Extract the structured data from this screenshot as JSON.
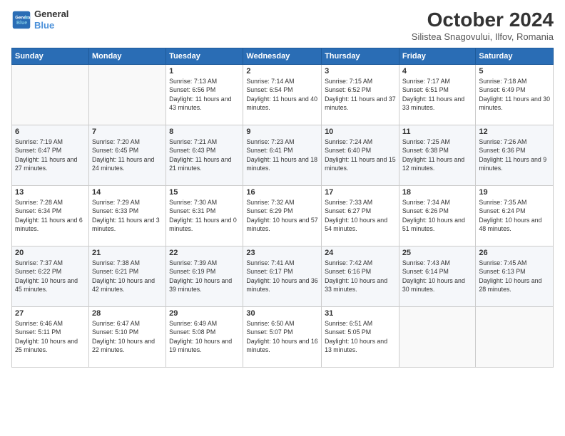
{
  "header": {
    "logo_line1": "General",
    "logo_line2": "Blue",
    "month_title": "October 2024",
    "subtitle": "Silistea Snagovului, Ilfov, Romania"
  },
  "days_of_week": [
    "Sunday",
    "Monday",
    "Tuesday",
    "Wednesday",
    "Thursday",
    "Friday",
    "Saturday"
  ],
  "weeks": [
    [
      {
        "day": "",
        "text": ""
      },
      {
        "day": "",
        "text": ""
      },
      {
        "day": "1",
        "text": "Sunrise: 7:13 AM\nSunset: 6:56 PM\nDaylight: 11 hours and 43 minutes."
      },
      {
        "day": "2",
        "text": "Sunrise: 7:14 AM\nSunset: 6:54 PM\nDaylight: 11 hours and 40 minutes."
      },
      {
        "day": "3",
        "text": "Sunrise: 7:15 AM\nSunset: 6:52 PM\nDaylight: 11 hours and 37 minutes."
      },
      {
        "day": "4",
        "text": "Sunrise: 7:17 AM\nSunset: 6:51 PM\nDaylight: 11 hours and 33 minutes."
      },
      {
        "day": "5",
        "text": "Sunrise: 7:18 AM\nSunset: 6:49 PM\nDaylight: 11 hours and 30 minutes."
      }
    ],
    [
      {
        "day": "6",
        "text": "Sunrise: 7:19 AM\nSunset: 6:47 PM\nDaylight: 11 hours and 27 minutes."
      },
      {
        "day": "7",
        "text": "Sunrise: 7:20 AM\nSunset: 6:45 PM\nDaylight: 11 hours and 24 minutes."
      },
      {
        "day": "8",
        "text": "Sunrise: 7:21 AM\nSunset: 6:43 PM\nDaylight: 11 hours and 21 minutes."
      },
      {
        "day": "9",
        "text": "Sunrise: 7:23 AM\nSunset: 6:41 PM\nDaylight: 11 hours and 18 minutes."
      },
      {
        "day": "10",
        "text": "Sunrise: 7:24 AM\nSunset: 6:40 PM\nDaylight: 11 hours and 15 minutes."
      },
      {
        "day": "11",
        "text": "Sunrise: 7:25 AM\nSunset: 6:38 PM\nDaylight: 11 hours and 12 minutes."
      },
      {
        "day": "12",
        "text": "Sunrise: 7:26 AM\nSunset: 6:36 PM\nDaylight: 11 hours and 9 minutes."
      }
    ],
    [
      {
        "day": "13",
        "text": "Sunrise: 7:28 AM\nSunset: 6:34 PM\nDaylight: 11 hours and 6 minutes."
      },
      {
        "day": "14",
        "text": "Sunrise: 7:29 AM\nSunset: 6:33 PM\nDaylight: 11 hours and 3 minutes."
      },
      {
        "day": "15",
        "text": "Sunrise: 7:30 AM\nSunset: 6:31 PM\nDaylight: 11 hours and 0 minutes."
      },
      {
        "day": "16",
        "text": "Sunrise: 7:32 AM\nSunset: 6:29 PM\nDaylight: 10 hours and 57 minutes."
      },
      {
        "day": "17",
        "text": "Sunrise: 7:33 AM\nSunset: 6:27 PM\nDaylight: 10 hours and 54 minutes."
      },
      {
        "day": "18",
        "text": "Sunrise: 7:34 AM\nSunset: 6:26 PM\nDaylight: 10 hours and 51 minutes."
      },
      {
        "day": "19",
        "text": "Sunrise: 7:35 AM\nSunset: 6:24 PM\nDaylight: 10 hours and 48 minutes."
      }
    ],
    [
      {
        "day": "20",
        "text": "Sunrise: 7:37 AM\nSunset: 6:22 PM\nDaylight: 10 hours and 45 minutes."
      },
      {
        "day": "21",
        "text": "Sunrise: 7:38 AM\nSunset: 6:21 PM\nDaylight: 10 hours and 42 minutes."
      },
      {
        "day": "22",
        "text": "Sunrise: 7:39 AM\nSunset: 6:19 PM\nDaylight: 10 hours and 39 minutes."
      },
      {
        "day": "23",
        "text": "Sunrise: 7:41 AM\nSunset: 6:17 PM\nDaylight: 10 hours and 36 minutes."
      },
      {
        "day": "24",
        "text": "Sunrise: 7:42 AM\nSunset: 6:16 PM\nDaylight: 10 hours and 33 minutes."
      },
      {
        "day": "25",
        "text": "Sunrise: 7:43 AM\nSunset: 6:14 PM\nDaylight: 10 hours and 30 minutes."
      },
      {
        "day": "26",
        "text": "Sunrise: 7:45 AM\nSunset: 6:13 PM\nDaylight: 10 hours and 28 minutes."
      }
    ],
    [
      {
        "day": "27",
        "text": "Sunrise: 6:46 AM\nSunset: 5:11 PM\nDaylight: 10 hours and 25 minutes."
      },
      {
        "day": "28",
        "text": "Sunrise: 6:47 AM\nSunset: 5:10 PM\nDaylight: 10 hours and 22 minutes."
      },
      {
        "day": "29",
        "text": "Sunrise: 6:49 AM\nSunset: 5:08 PM\nDaylight: 10 hours and 19 minutes."
      },
      {
        "day": "30",
        "text": "Sunrise: 6:50 AM\nSunset: 5:07 PM\nDaylight: 10 hours and 16 minutes."
      },
      {
        "day": "31",
        "text": "Sunrise: 6:51 AM\nSunset: 5:05 PM\nDaylight: 10 hours and 13 minutes."
      },
      {
        "day": "",
        "text": ""
      },
      {
        "day": "",
        "text": ""
      }
    ]
  ]
}
